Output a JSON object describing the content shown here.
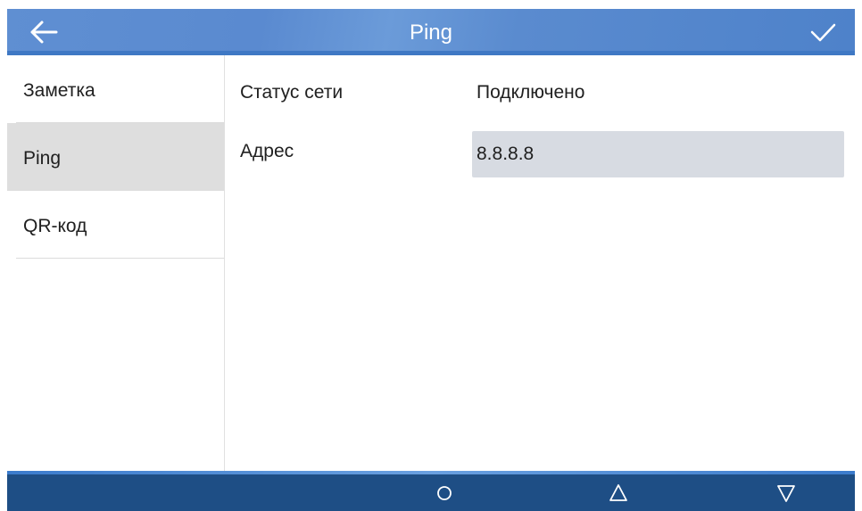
{
  "header": {
    "title": "Ping",
    "back_icon": "arrow-left-icon",
    "confirm_icon": "checkmark-icon",
    "accent_color": "#5a8ad0"
  },
  "sidebar": {
    "items": [
      {
        "label": "Заметка",
        "active": false
      },
      {
        "label": "Ping",
        "active": true
      },
      {
        "label": "QR-код",
        "active": false
      }
    ]
  },
  "main": {
    "network_status_label": "Статус сети",
    "network_status_value": "Подключено",
    "address_label": "Адрес",
    "address_value": "8.8.8.8"
  },
  "navbar": {
    "background_color": "#1e4e85",
    "buttons": [
      "home-circle-icon",
      "up-triangle-icon",
      "down-triangle-icon"
    ]
  }
}
